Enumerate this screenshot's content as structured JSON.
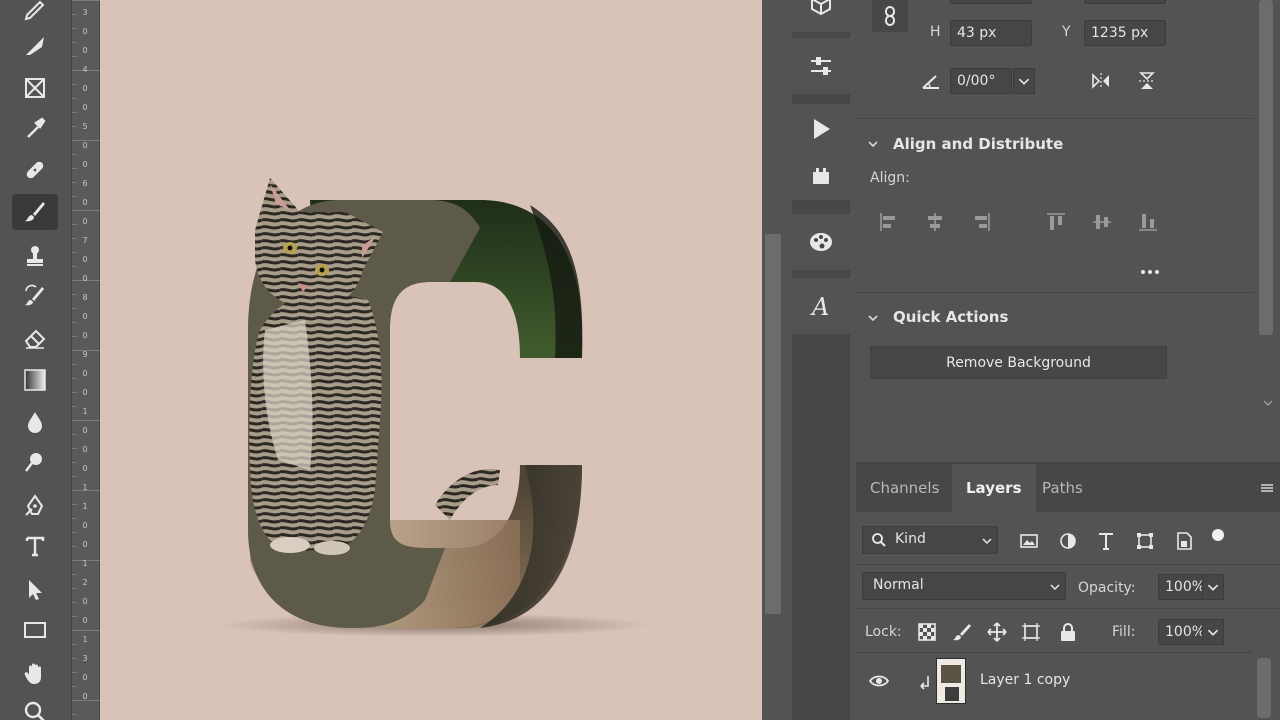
{
  "properties": {
    "h_label": "H",
    "h_value": "43 px",
    "y_label": "Y",
    "y_value": "1235 px",
    "angle_value": "0/00°",
    "align_distribute_title": "Align and Distribute",
    "align_label": "Align:",
    "quick_actions_title": "Quick Actions",
    "remove_background_label": "Remove Background"
  },
  "layers_panel": {
    "tabs": [
      {
        "label": "Channels"
      },
      {
        "label": "Layers"
      },
      {
        "label": "Paths"
      }
    ],
    "filter_kind": "Kind",
    "blend_mode": "Normal",
    "opacity_label": "Opacity:",
    "opacity_value": "100%",
    "lock_label": "Lock:",
    "fill_label": "Fill:",
    "fill_value": "100%",
    "layers": [
      {
        "name": "Layer 1 copy"
      }
    ]
  },
  "ruler": {
    "labels": [
      "3",
      "0",
      "0",
      "4",
      "0",
      "0",
      "5",
      "0",
      "0",
      "6",
      "0",
      "0",
      "7",
      "0",
      "0",
      "8",
      "0",
      "0",
      "9",
      "0",
      "0",
      "1",
      "0",
      "0",
      "0",
      "1",
      "1",
      "0",
      "0",
      "1",
      "2",
      "0",
      "0",
      "1",
      "3",
      "0",
      "0"
    ]
  },
  "colors": {
    "ui_gray": "#535353",
    "canvas_background": "#d9c3b8"
  }
}
